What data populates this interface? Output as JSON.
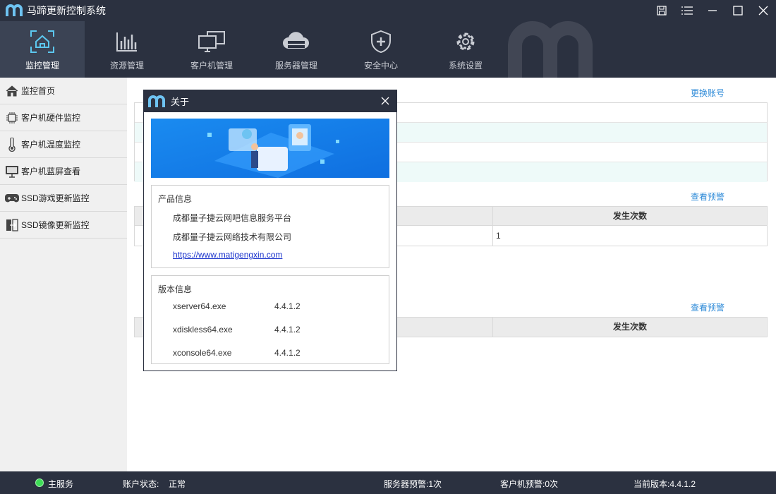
{
  "app": {
    "title": "马蹄更新控制系统"
  },
  "nav": {
    "items": [
      {
        "label": "监控管理",
        "icon": "monitor-home-icon",
        "active": true
      },
      {
        "label": "资源管理",
        "icon": "bar-chart-icon"
      },
      {
        "label": "客户机管理",
        "icon": "client-computers-icon"
      },
      {
        "label": "服务器管理",
        "icon": "cloud-server-icon"
      },
      {
        "label": "安全中心",
        "icon": "shield-icon"
      },
      {
        "label": "系统设置",
        "icon": "gear-icon"
      }
    ]
  },
  "sidebar": {
    "items": [
      {
        "label": "监控首页",
        "icon": "home-icon"
      },
      {
        "label": "客户机硬件监控",
        "icon": "chip-icon"
      },
      {
        "label": "客户机温度监控",
        "icon": "thermometer-icon"
      },
      {
        "label": "客户机蓝屏查看",
        "icon": "screen-icon"
      },
      {
        "label": "SSD游戏更新监控",
        "icon": "gamepad-icon"
      },
      {
        "label": "SSD镜像更新监控",
        "icon": "mirror-update-icon"
      }
    ]
  },
  "main": {
    "switch_account": "更换账号",
    "view_alert_1": "查看预警",
    "view_alert_2": "查看预警",
    "table1": {
      "header_count": "发生次数",
      "row_count": "1"
    },
    "table2": {
      "header_count": "发生次数"
    }
  },
  "dialog": {
    "title": "关于",
    "product_group_title": "产品信息",
    "product_lines": [
      "成都量子捷云网吧信息服务平台",
      "成都量子捷云网络技术有限公司"
    ],
    "website": "https://www.matigengxin.com",
    "version_group_title": "版本信息",
    "versions": [
      {
        "name": "xserver64.exe",
        "version": "4.4.1.2"
      },
      {
        "name": "xdiskless64.exe",
        "version": "4.4.1.2"
      },
      {
        "name": "xconsole64.exe",
        "version": "4.4.1.2"
      }
    ]
  },
  "status": {
    "main_service": "主服务",
    "account_label": "账户状态:",
    "account_value": "正常",
    "server_alert": "服务器预警:1次",
    "client_alert": "客户机预警:0次",
    "current_version": "当前版本:4.4.1.2"
  },
  "colors": {
    "dark_bg": "#2b3140",
    "accent": "#2f8bd8",
    "nav_active_icon": "#5cc8f0",
    "status_ok": "#3ddc56"
  }
}
